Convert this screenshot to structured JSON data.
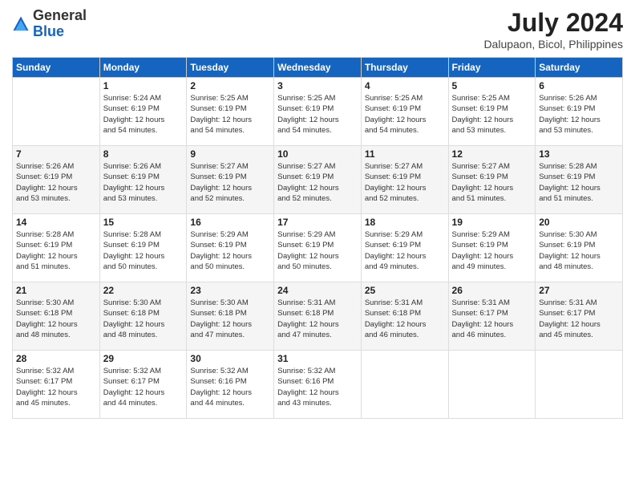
{
  "header": {
    "logo_general": "General",
    "logo_blue": "Blue",
    "month_year": "July 2024",
    "location": "Dalupaon, Bicol, Philippines"
  },
  "days_of_week": [
    "Sunday",
    "Monday",
    "Tuesday",
    "Wednesday",
    "Thursday",
    "Friday",
    "Saturday"
  ],
  "weeks": [
    [
      {
        "day": "",
        "info": ""
      },
      {
        "day": "1",
        "info": "Sunrise: 5:24 AM\nSunset: 6:19 PM\nDaylight: 12 hours\nand 54 minutes."
      },
      {
        "day": "2",
        "info": "Sunrise: 5:25 AM\nSunset: 6:19 PM\nDaylight: 12 hours\nand 54 minutes."
      },
      {
        "day": "3",
        "info": "Sunrise: 5:25 AM\nSunset: 6:19 PM\nDaylight: 12 hours\nand 54 minutes."
      },
      {
        "day": "4",
        "info": "Sunrise: 5:25 AM\nSunset: 6:19 PM\nDaylight: 12 hours\nand 54 minutes."
      },
      {
        "day": "5",
        "info": "Sunrise: 5:25 AM\nSunset: 6:19 PM\nDaylight: 12 hours\nand 53 minutes."
      },
      {
        "day": "6",
        "info": "Sunrise: 5:26 AM\nSunset: 6:19 PM\nDaylight: 12 hours\nand 53 minutes."
      }
    ],
    [
      {
        "day": "7",
        "info": "Sunrise: 5:26 AM\nSunset: 6:19 PM\nDaylight: 12 hours\nand 53 minutes."
      },
      {
        "day": "8",
        "info": "Sunrise: 5:26 AM\nSunset: 6:19 PM\nDaylight: 12 hours\nand 53 minutes."
      },
      {
        "day": "9",
        "info": "Sunrise: 5:27 AM\nSunset: 6:19 PM\nDaylight: 12 hours\nand 52 minutes."
      },
      {
        "day": "10",
        "info": "Sunrise: 5:27 AM\nSunset: 6:19 PM\nDaylight: 12 hours\nand 52 minutes."
      },
      {
        "day": "11",
        "info": "Sunrise: 5:27 AM\nSunset: 6:19 PM\nDaylight: 12 hours\nand 52 minutes."
      },
      {
        "day": "12",
        "info": "Sunrise: 5:27 AM\nSunset: 6:19 PM\nDaylight: 12 hours\nand 51 minutes."
      },
      {
        "day": "13",
        "info": "Sunrise: 5:28 AM\nSunset: 6:19 PM\nDaylight: 12 hours\nand 51 minutes."
      }
    ],
    [
      {
        "day": "14",
        "info": "Sunrise: 5:28 AM\nSunset: 6:19 PM\nDaylight: 12 hours\nand 51 minutes."
      },
      {
        "day": "15",
        "info": "Sunrise: 5:28 AM\nSunset: 6:19 PM\nDaylight: 12 hours\nand 50 minutes."
      },
      {
        "day": "16",
        "info": "Sunrise: 5:29 AM\nSunset: 6:19 PM\nDaylight: 12 hours\nand 50 minutes."
      },
      {
        "day": "17",
        "info": "Sunrise: 5:29 AM\nSunset: 6:19 PM\nDaylight: 12 hours\nand 50 minutes."
      },
      {
        "day": "18",
        "info": "Sunrise: 5:29 AM\nSunset: 6:19 PM\nDaylight: 12 hours\nand 49 minutes."
      },
      {
        "day": "19",
        "info": "Sunrise: 5:29 AM\nSunset: 6:19 PM\nDaylight: 12 hours\nand 49 minutes."
      },
      {
        "day": "20",
        "info": "Sunrise: 5:30 AM\nSunset: 6:19 PM\nDaylight: 12 hours\nand 48 minutes."
      }
    ],
    [
      {
        "day": "21",
        "info": "Sunrise: 5:30 AM\nSunset: 6:18 PM\nDaylight: 12 hours\nand 48 minutes."
      },
      {
        "day": "22",
        "info": "Sunrise: 5:30 AM\nSunset: 6:18 PM\nDaylight: 12 hours\nand 48 minutes."
      },
      {
        "day": "23",
        "info": "Sunrise: 5:30 AM\nSunset: 6:18 PM\nDaylight: 12 hours\nand 47 minutes."
      },
      {
        "day": "24",
        "info": "Sunrise: 5:31 AM\nSunset: 6:18 PM\nDaylight: 12 hours\nand 47 minutes."
      },
      {
        "day": "25",
        "info": "Sunrise: 5:31 AM\nSunset: 6:18 PM\nDaylight: 12 hours\nand 46 minutes."
      },
      {
        "day": "26",
        "info": "Sunrise: 5:31 AM\nSunset: 6:17 PM\nDaylight: 12 hours\nand 46 minutes."
      },
      {
        "day": "27",
        "info": "Sunrise: 5:31 AM\nSunset: 6:17 PM\nDaylight: 12 hours\nand 45 minutes."
      }
    ],
    [
      {
        "day": "28",
        "info": "Sunrise: 5:32 AM\nSunset: 6:17 PM\nDaylight: 12 hours\nand 45 minutes."
      },
      {
        "day": "29",
        "info": "Sunrise: 5:32 AM\nSunset: 6:17 PM\nDaylight: 12 hours\nand 44 minutes."
      },
      {
        "day": "30",
        "info": "Sunrise: 5:32 AM\nSunset: 6:16 PM\nDaylight: 12 hours\nand 44 minutes."
      },
      {
        "day": "31",
        "info": "Sunrise: 5:32 AM\nSunset: 6:16 PM\nDaylight: 12 hours\nand 43 minutes."
      },
      {
        "day": "",
        "info": ""
      },
      {
        "day": "",
        "info": ""
      },
      {
        "day": "",
        "info": ""
      }
    ]
  ]
}
